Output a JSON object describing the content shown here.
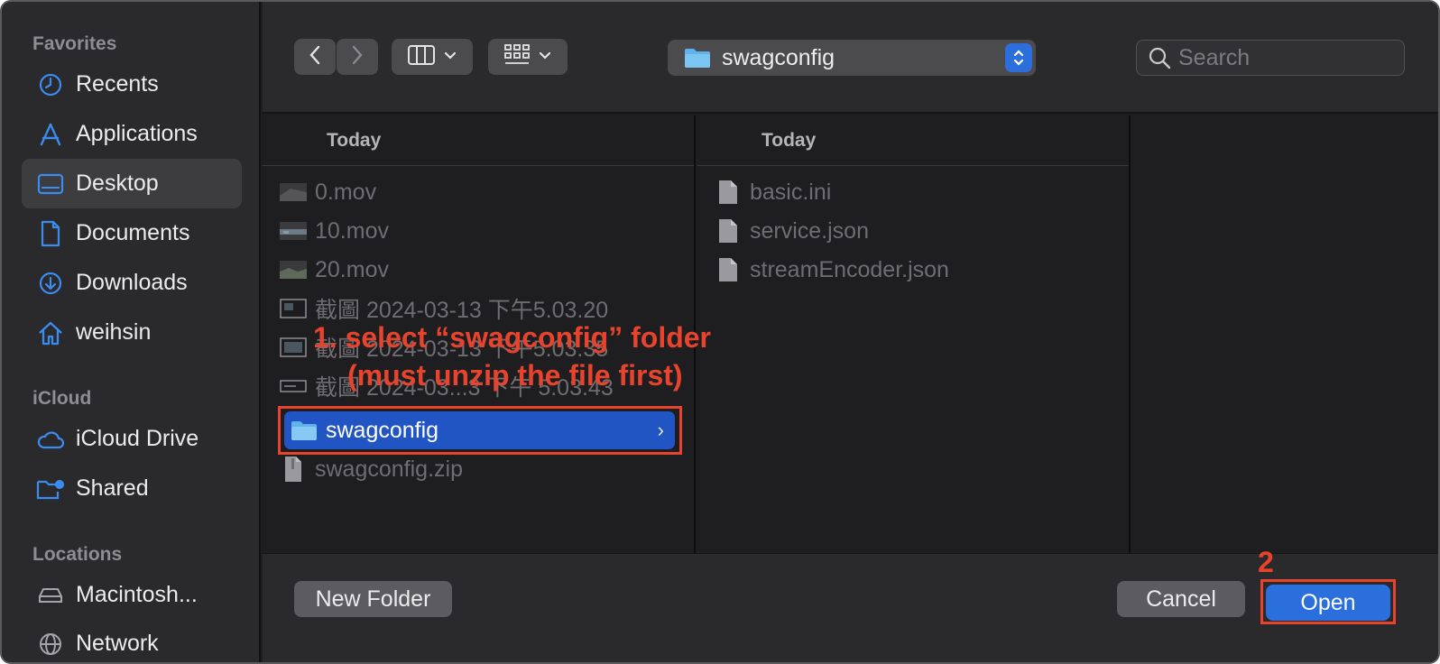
{
  "sidebar": {
    "sections": {
      "favorites": "Favorites",
      "icloud": "iCloud",
      "locations": "Locations"
    },
    "items": [
      {
        "label": "Recents",
        "icon": "clock-icon"
      },
      {
        "label": "Applications",
        "icon": "applications-icon"
      },
      {
        "label": "Desktop",
        "icon": "desktop-icon",
        "selected": true
      },
      {
        "label": "Documents",
        "icon": "document-icon"
      },
      {
        "label": "Downloads",
        "icon": "download-icon"
      },
      {
        "label": "weihsin",
        "icon": "home-icon"
      },
      {
        "label": "iCloud Drive",
        "icon": "cloud-icon"
      },
      {
        "label": "Shared",
        "icon": "shared-folder-icon"
      },
      {
        "label": "Macintosh...",
        "icon": "disk-icon"
      },
      {
        "label": "Network",
        "icon": "globe-icon"
      }
    ]
  },
  "toolbar": {
    "path": "swagconfig",
    "search_placeholder": "Search"
  },
  "columns": [
    {
      "header": "Today",
      "files": [
        {
          "name": "0.mov",
          "type": "video"
        },
        {
          "name": "10.mov",
          "type": "video"
        },
        {
          "name": "20.mov",
          "type": "video"
        },
        {
          "name": "截圖 2024-03-13 下午5.03.20",
          "type": "image"
        },
        {
          "name": "截圖 2024-03-13 下午5.03.35",
          "type": "image"
        },
        {
          "name": "截圖 2024-03...3 下午 5.03.43",
          "type": "image"
        },
        {
          "name": "swagconfig",
          "type": "folder",
          "selected": true
        },
        {
          "name": "swagconfig.zip",
          "type": "zip"
        }
      ]
    },
    {
      "header": "Today",
      "files": [
        {
          "name": "basic.ini",
          "type": "document"
        },
        {
          "name": "service.json",
          "type": "document"
        },
        {
          "name": "streamEncoder.json",
          "type": "document"
        }
      ]
    }
  ],
  "annotations": {
    "step1_line1": "1. select “swagconfig” folder",
    "step1_line2": "(must unzip the file first)",
    "step2": "2"
  },
  "buttons": {
    "new_folder": "New Folder",
    "cancel": "Cancel",
    "open": "Open"
  },
  "colors": {
    "accent": "#2b6fdd",
    "selection": "#2155c4",
    "annotation": "#e8432d",
    "folder": "#5fb3ea"
  }
}
